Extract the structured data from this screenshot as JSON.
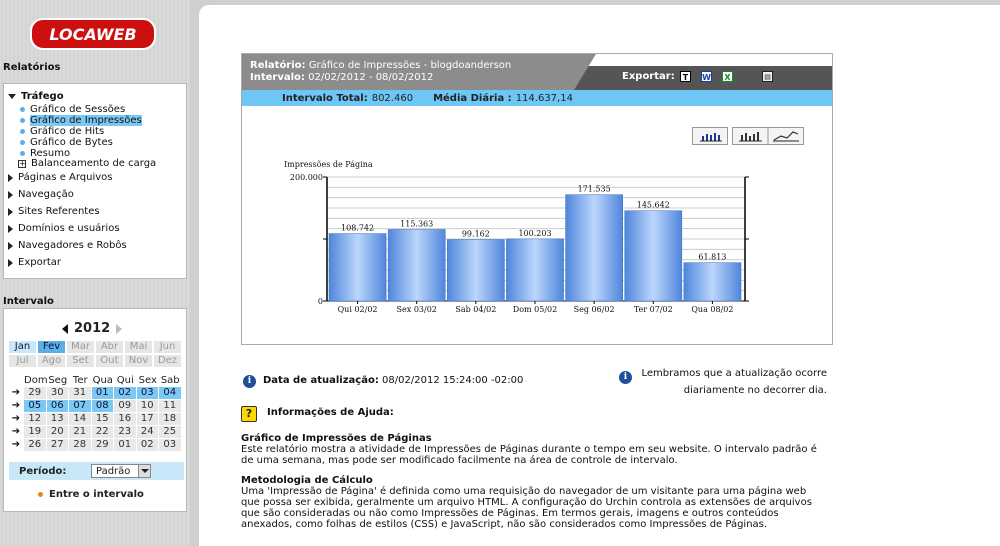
{
  "logo_text": "LOCAWEB",
  "sidebar": {
    "reports_title": "Relatórios",
    "groups": [
      {
        "label": "Tráfego",
        "expanded": true
      },
      {
        "label": "Páginas e Arquivos"
      },
      {
        "label": "Navegação"
      },
      {
        "label": "Sites Referentes"
      },
      {
        "label": "Domínios e usuários"
      },
      {
        "label": "Navegadores e Robôs"
      },
      {
        "label": "Exportar"
      }
    ],
    "traffic_items": [
      "Gráfico de Sessões",
      "Gráfico de Impressões",
      "Gráfico de Hits",
      "Gráfico de Bytes",
      "Resumo",
      "Balanceamento de carga"
    ],
    "interval_title": "Intervalo"
  },
  "calendar": {
    "year": "2012",
    "months": [
      "Jan",
      "Fev",
      "Mar",
      "Abr",
      "Mai",
      "Jun",
      "Jul",
      "Ago",
      "Set",
      "Out",
      "Nov",
      "Dez"
    ],
    "weekdays": [
      "Dom",
      "Seg",
      "Ter",
      "Qua",
      "Qui",
      "Sex",
      "Sab"
    ],
    "weeks": [
      [
        "29",
        "30",
        "31",
        "01",
        "02",
        "03",
        "04"
      ],
      [
        "05",
        "06",
        "07",
        "08",
        "09",
        "10",
        "11"
      ],
      [
        "12",
        "13",
        "14",
        "15",
        "16",
        "17",
        "18"
      ],
      [
        "19",
        "20",
        "21",
        "22",
        "23",
        "24",
        "25"
      ],
      [
        "26",
        "27",
        "28",
        "29",
        "01",
        "02",
        "03"
      ]
    ],
    "period_label": "Período:",
    "period_value": "Padrão",
    "between_label": "Entre o intervalo"
  },
  "report": {
    "report_label": "Relatório:",
    "report_value": "Gráfico de Impressões - blogdoanderson",
    "interval_label": "Intervalo:",
    "interval_value": "02/02/2012 - 08/02/2012",
    "export_label": "Exportar:",
    "total_label": "Intervalo Total:",
    "total_value": "802.460",
    "daily_label": "Média Diária :",
    "daily_value": "114.637,14"
  },
  "chart_data": {
    "type": "bar",
    "ylabel": "Impressões de Página",
    "ylim": [
      0,
      200000
    ],
    "ytick_labels": [
      "200.000",
      "0"
    ],
    "categories": [
      "Qui 02/02",
      "Sex 03/02",
      "Sab 04/02",
      "Dom 05/02",
      "Seg 06/02",
      "Ter 07/02",
      "Qua 08/02"
    ],
    "values": [
      108742,
      115363,
      99162,
      100203,
      171535,
      145642,
      61813
    ],
    "value_labels": [
      "108.742",
      "115.363",
      "99.162",
      "100.203",
      "171.535",
      "145.642",
      "61.813"
    ]
  },
  "info": {
    "update_label": "Data de atualização:",
    "update_value": "08/02/2012 15:24:00 -02:00",
    "reminder_line1": "Lembramos que a atualização ocorre",
    "reminder_line2": "diariamente no decorrer dia.",
    "help_title": "Informações de Ajuda:",
    "s1_title": "Gráfico de Impressões de Páginas",
    "s1_lines": [
      "Este relatório mostra a atividade de Impressões de Páginas durante o tempo em seu website. O intervalo padrão é",
      "de uma semana, mas pode ser modificado facilmente na área de controle de intervalo."
    ],
    "s2_title": "Metodologia de Cálculo",
    "s2_lines": [
      "Uma 'Impressão de Página' é definida como uma requisição do navegador de um visitante para uma página web",
      "que possa ser exibida, geralmente um arquivo HTML. A configuração do Urchin controla as extensões de arquivos",
      "que são consideradas ou não como Impressões de Páginas. Em termos gerais, imagens e outros conteúdos",
      "anexados, como folhas de estilos (CSS) e JavaScript, não são considerados como Impressões de Páginas."
    ]
  }
}
